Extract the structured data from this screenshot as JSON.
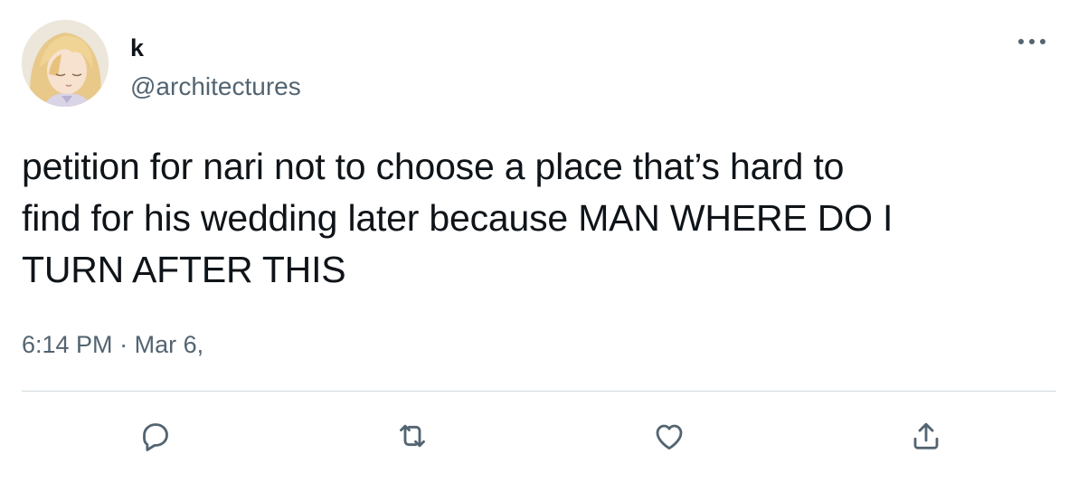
{
  "author": {
    "display_name": "k",
    "handle": "@architectures"
  },
  "tweet": {
    "text": "petition for nari not to choose a place that’s hard to\nfind for his wedding later because MAN WHERE DO I\nTURN AFTER THIS",
    "time": "6:14 PM",
    "separator": "·",
    "date": "Mar 6,"
  },
  "icons": {
    "more": "more-horizontal-icon",
    "reply": "reply-icon",
    "retweet": "retweet-icon",
    "like": "heart-icon",
    "share": "share-icon"
  },
  "colors": {
    "text": "#0f1419",
    "secondary": "#536471",
    "divider": "#cfd9de"
  }
}
